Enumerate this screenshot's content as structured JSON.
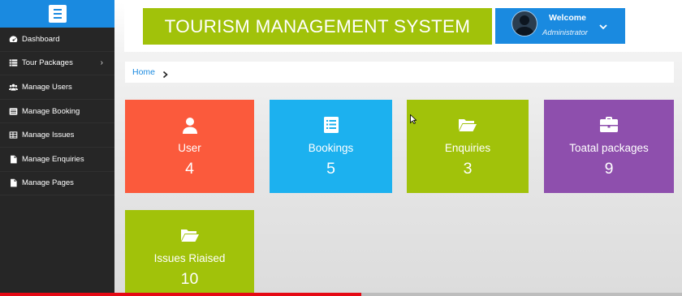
{
  "sidebar": {
    "toggle_icon": "hamburger-icon",
    "items": [
      {
        "label": "Dashboard",
        "icon": "dashboard-icon",
        "has_submenu": false
      },
      {
        "label": "Tour Packages",
        "icon": "list-icon",
        "has_submenu": true
      },
      {
        "label": "Manage Users",
        "icon": "users-icon",
        "has_submenu": false
      },
      {
        "label": "Manage Booking",
        "icon": "booking-icon",
        "has_submenu": false
      },
      {
        "label": "Manage Issues",
        "icon": "table-icon",
        "has_submenu": false
      },
      {
        "label": "Manage Enquiries",
        "icon": "file-icon",
        "has_submenu": false
      },
      {
        "label": "Manage Pages",
        "icon": "file-icon",
        "has_submenu": false
      }
    ]
  },
  "header": {
    "title": "TOURISM MANAGEMENT SYSTEM",
    "welcome": "Welcome",
    "role": "Administrator"
  },
  "breadcrumb": {
    "home": "Home"
  },
  "tiles": [
    {
      "label": "User",
      "value": "4",
      "icon": "user-icon",
      "color": "#fb5a3c"
    },
    {
      "label": "Bookings",
      "value": "5",
      "icon": "list-alt-icon",
      "color": "#1cb1ef"
    },
    {
      "label": "Enquiries",
      "value": "3",
      "icon": "folder-open-icon",
      "color": "#a1c20a"
    },
    {
      "label": "Toatal packages",
      "value": "9",
      "icon": "briefcase-icon",
      "color": "#8e4fad"
    },
    {
      "label": "Issues Riaised",
      "value": "10",
      "icon": "folder-open-icon",
      "color": "#a1c20a"
    }
  ],
  "colors": {
    "accent": "#1a8ae0",
    "sidebar_bg": "#262626",
    "title_bg": "#a1c20a"
  },
  "video_progress": 0.53
}
